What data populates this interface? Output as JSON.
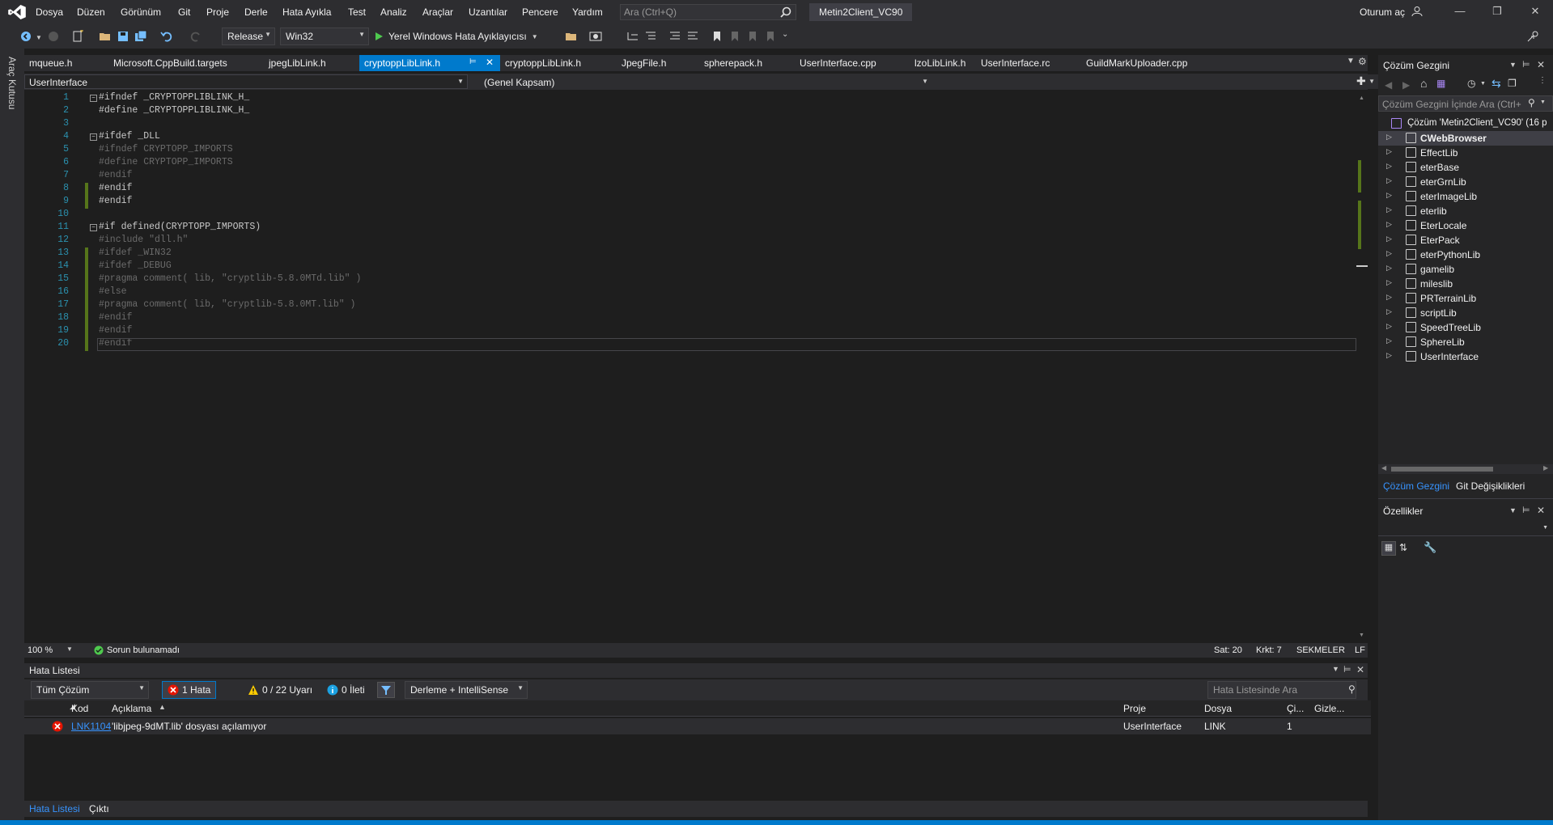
{
  "menu": {
    "items": [
      "Dosya",
      "Düzen",
      "Görünüm",
      "Git",
      "Proje",
      "Derle",
      "Hata Ayıkla",
      "Test",
      "Analiz",
      "Araçlar",
      "Uzantılar",
      "Pencere",
      "Yardım"
    ],
    "search_placeholder": "Ara (Ctrl+Q)",
    "window_title": "Metin2Client_VC90",
    "sign_in": "Oturum aç"
  },
  "toolbar": {
    "configuration": "Release",
    "platform": "Win32",
    "debugger": "Yerel Windows Hata Ayıklayıcısı"
  },
  "left_strip": {
    "label": "Araç Kutusu"
  },
  "doc_tabs": [
    "mqueue.h",
    "Microsoft.CppBuild.targets",
    "jpegLibLink.h",
    "cryptoppLibLink.h",
    "cryptoppLibLink.h",
    "JpegFile.h",
    "spherepack.h",
    "UserInterface.cpp",
    "lzoLibLink.h",
    "UserInterface.rc",
    "GuildMarkUploader.cpp"
  ],
  "active_tab_index": 3,
  "nav": {
    "project": "UserInterface",
    "scope": "(Genel Kapsam)"
  },
  "code_lines": [
    "#ifndef _CRYPTOPPLIBLINK_H_",
    "#define _CRYPTOPPLIBLINK_H_",
    "",
    "#ifdef _DLL",
    "#ifndef CRYPTOPP_IMPORTS",
    "#define CRYPTOPP_IMPORTS",
    "#endif",
    "#endif",
    "#endif",
    "",
    "#if defined(CRYPTOPP_IMPORTS)",
    "#include \"dll.h\"",
    "#ifdef _WIN32",
    "#ifdef _DEBUG",
    "#pragma comment( lib, \"cryptlib-5.8.0MTd.lib\" )",
    "#else",
    "#pragma comment( lib, \"cryptlib-5.8.0MT.lib\" )",
    "#endif",
    "#endif",
    "#endif"
  ],
  "line_numbers": [
    "1",
    "2",
    "3",
    "4",
    "5",
    "6",
    "7",
    "8",
    "9",
    "10",
    "11",
    "12",
    "13",
    "14",
    "15",
    "16",
    "17",
    "18",
    "19",
    "20"
  ],
  "editor_status": {
    "zoom": "100 %",
    "issues": "Sorun bulunamadı",
    "line": "Sat: 20",
    "col": "Krkt: 7",
    "tabs": "SEKMELER",
    "eol": "LF"
  },
  "error_list": {
    "title": "Hata Listesi",
    "scope": "Tüm Çözüm",
    "errors": "1 Hata",
    "warnings": "0 / 22 Uyarı",
    "messages": "0 İleti",
    "build_filter": "Derleme + IntelliSense",
    "search_placeholder": "Hata Listesinde Ara",
    "columns": [
      "Kod",
      "Açıklama",
      "Proje",
      "Dosya",
      "Çi...",
      "Gizle..."
    ],
    "rows": [
      {
        "code": "LNK1104",
        "description": "'libjpeg-9dMT.lib' dosyası açılamıyor",
        "project": "UserInterface",
        "file": "LINK",
        "line": "1",
        "suppressed": ""
      }
    ]
  },
  "bottom_tabs": [
    "Hata Listesi",
    "Çıktı"
  ],
  "solution_explorer": {
    "title": "Çözüm Gezgini",
    "search_placeholder": "Çözüm Gezgini İçinde Ara (Ctrl+",
    "solution": "Çözüm 'Metin2Client_VC90' (16 p",
    "projects": [
      "CWebBrowser",
      "EffectLib",
      "eterBase",
      "eterGrnLib",
      "eterImageLib",
      "eterlib",
      "EterLocale",
      "EterPack",
      "eterPythonLib",
      "gamelib",
      "mileslib",
      "PRTerrainLib",
      "scriptLib",
      "SpeedTreeLib",
      "SphereLib",
      "UserInterface"
    ],
    "tabs": [
      "Çözüm Gezgini",
      "Git Değişiklikleri"
    ]
  },
  "properties": {
    "title": "Özellikler"
  },
  "colors": {
    "accent": "#007acc",
    "error": "#e51400",
    "warning": "#ffcc00",
    "change_bar": "#56751a",
    "line_number": "#2b91af"
  }
}
